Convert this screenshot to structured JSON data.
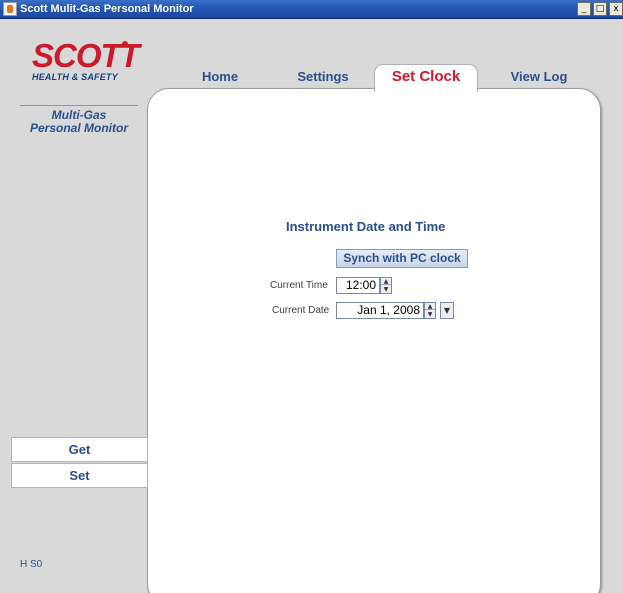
{
  "window": {
    "title": "Scott Mulit-Gas Personal Monitor",
    "controls": [
      "_",
      "□",
      "x"
    ]
  },
  "brand": {
    "logo": "SCOTT",
    "tagline": "HEALTH & SAFETY",
    "product_line1": "Multi-Gas",
    "product_line2": "Personal Monitor",
    "accent_color": "#cc1a2a",
    "label_color": "#2b4f8c"
  },
  "tabs": [
    {
      "label": "Home",
      "active": false
    },
    {
      "label": "Settings",
      "active": false
    },
    {
      "label": "Set Clock",
      "active": true
    },
    {
      "label": "View Log",
      "active": false
    }
  ],
  "clock": {
    "heading": "Instrument Date and Time",
    "sync_button": "Synch with PC clock",
    "time_label": "Current Time",
    "time_value": "12:00",
    "date_label": "Current Date",
    "date_value": "Jan 1, 2008"
  },
  "side_actions": {
    "get": "Get",
    "set": "Set"
  },
  "status": {
    "text": "H S0"
  },
  "icons": {
    "title": "java-cup-icon",
    "spinner_up": "spinner-up-icon",
    "spinner_down": "spinner-down-icon",
    "dropdown": "dropdown-arrow-icon"
  }
}
